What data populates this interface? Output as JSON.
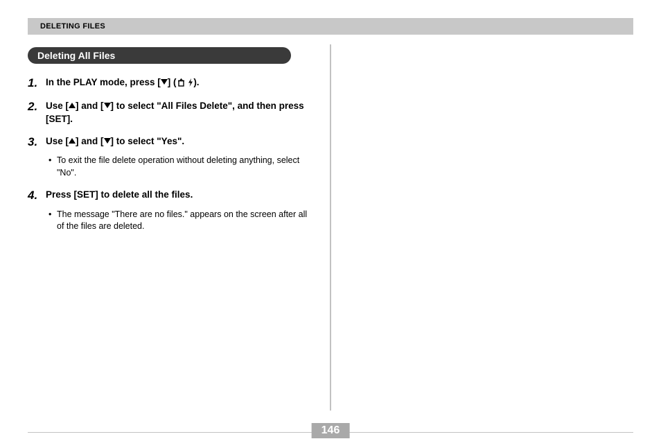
{
  "header": {
    "title": "DELETING FILES"
  },
  "section": {
    "title": "Deleting All Files"
  },
  "steps": [
    {
      "num": "1.",
      "prefix": "In the PLAY mode, press [",
      "mid_icon": "down",
      "after_mid": "] (",
      "suffix_icons": [
        "trash",
        "flash"
      ],
      "suffix": ")."
    },
    {
      "num": "2.",
      "text_parts": [
        "Use [",
        "up",
        "] and [",
        "down",
        "] to select \"All Files Delete\", and then press [SET]."
      ]
    },
    {
      "num": "3.",
      "text_parts": [
        "Use [",
        "up",
        "] and [",
        "down",
        "] to select \"Yes\"."
      ],
      "bullets": [
        "To exit the file delete operation without deleting anything, select \"No\"."
      ]
    },
    {
      "num": "4.",
      "plain": "Press [SET] to delete all the files.",
      "bullets": [
        "The message \"There are no files.\" appears on the screen after all of the files are deleted."
      ]
    }
  ],
  "icons": {
    "trash_name": "trash-icon",
    "flash_name": "flash-icon"
  },
  "pageNumber": "146"
}
